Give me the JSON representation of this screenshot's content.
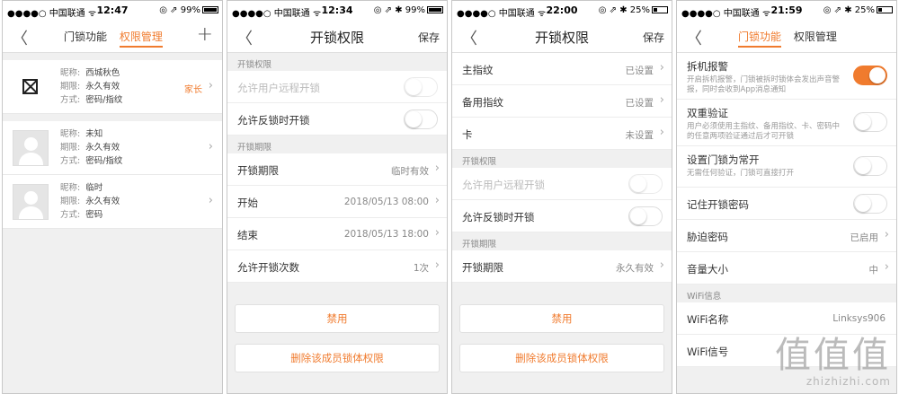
{
  "screens": [
    {
      "status": {
        "carrier": "●●●●○ 中国联通 ᯤ",
        "time": "12:47",
        "indicators": "◎ ⇗",
        "battery": "99%",
        "battery_level": 0.99
      },
      "tabs": [
        "门锁功能",
        "权限管理"
      ],
      "members": [
        {
          "fields": [
            [
              "昵称:",
              "西城秋色"
            ],
            [
              "期限:",
              "永久有效"
            ],
            [
              "方式:",
              "密码/指纹"
            ]
          ],
          "tag": "家长",
          "avatar": "broken-image-icon"
        },
        {
          "fields": [
            [
              "昵称:",
              "未知"
            ],
            [
              "期限:",
              "永久有效"
            ],
            [
              "方式:",
              "密码/指纹"
            ]
          ],
          "avatar": "user-avatar-icon"
        },
        {
          "fields": [
            [
              "昵称:",
              "临时"
            ],
            [
              "期限:",
              "永久有效"
            ],
            [
              "方式:",
              "密码"
            ]
          ],
          "avatar": "user-avatar-icon"
        }
      ]
    },
    {
      "status": {
        "carrier": "●●●●○ 中国联通 ᯤ",
        "time": "12:34",
        "indicators": "◎ ⇗ ✱",
        "battery": "99%",
        "battery_level": 0.99
      },
      "title": "开锁权限",
      "save": "保存",
      "sections": [
        {
          "title": "开锁权限",
          "rows": [
            {
              "label": "允许用户远程开锁",
              "toggle": false,
              "disabled": true
            },
            {
              "label": "允许反锁时开锁",
              "toggle": false
            }
          ]
        },
        {
          "title": "开锁期限",
          "rows": [
            {
              "label": "开锁期限",
              "value": "临时有效"
            },
            {
              "label": "开始",
              "value": "2018/05/13  08:00"
            },
            {
              "label": "结束",
              "value": "2018/05/13  18:00"
            },
            {
              "label": "允许开锁次数",
              "value": "1次"
            }
          ]
        }
      ],
      "buttons": [
        "禁用",
        "删除该成员锁体权限"
      ]
    },
    {
      "status": {
        "carrier": "●●●●○ 中国联通 ᯤ",
        "time": "22:00",
        "indicators": "◎ ⇗ ✱",
        "battery": "25%",
        "battery_level": 0.25
      },
      "title": "开锁权限",
      "save": "保存",
      "top_rows": [
        {
          "label": "主指纹",
          "value": "已设置"
        },
        {
          "label": "备用指纹",
          "value": "已设置"
        },
        {
          "label": "卡",
          "value": "未设置"
        }
      ],
      "sections": [
        {
          "title": "开锁权限",
          "rows": [
            {
              "label": "允许用户远程开锁",
              "toggle": false,
              "disabled": true
            },
            {
              "label": "允许反锁时开锁",
              "toggle": false
            }
          ]
        },
        {
          "title": "开锁期限",
          "rows": [
            {
              "label": "开锁期限",
              "value": "永久有效"
            }
          ]
        }
      ],
      "buttons": [
        "禁用",
        "删除该成员锁体权限"
      ]
    },
    {
      "status": {
        "carrier": "●●●●○ 中国联通 ᯤ",
        "time": "21:59",
        "indicators": "◎ ⇗ ✱",
        "battery": "25%",
        "battery_level": 0.25
      },
      "tabs": [
        "门锁功能",
        "权限管理"
      ],
      "toggle_rows": [
        {
          "label": "拆机报警",
          "desc": "开启拆机报警，门锁被拆时锁体会发出声音警报，同时会收到App消息通知",
          "on": true
        },
        {
          "label": "双重验证",
          "desc": "用户必须使用主指纹、备用指纹、卡、密码中的任意两项验证通过后才可开锁",
          "on": false
        },
        {
          "label": "设置门锁为常开",
          "desc": "无需任何验证，门锁可直接打开",
          "on": false
        }
      ],
      "rows": [
        {
          "label": "记住开锁密码",
          "toggle": false
        },
        {
          "label": "胁迫密码",
          "value": "已启用"
        },
        {
          "label": "音量大小",
          "value": "中"
        }
      ],
      "wifi_section": "WiFi信息",
      "wifi_rows": [
        {
          "label": "WiFi名称",
          "value": "Linksys906"
        },
        {
          "label": "WiFi信号",
          "value": ""
        }
      ]
    }
  ],
  "watermark": {
    "chars": "值值值",
    "url": "zhizhizhi.com"
  },
  "colors": {
    "accent": "#f07b2e",
    "background": "#f0f0f0"
  }
}
